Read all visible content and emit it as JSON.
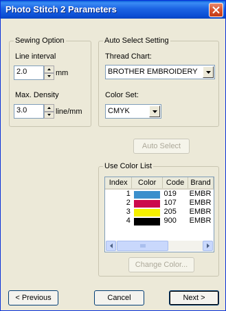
{
  "window": {
    "title": "Photo Stitch 2 Parameters"
  },
  "sewing_option": {
    "legend": "Sewing Option",
    "line_interval": {
      "label": "Line interval",
      "value": "2.0",
      "unit": "mm"
    },
    "max_density": {
      "label": "Max. Density",
      "value": "3.0",
      "unit": "line/mm"
    }
  },
  "auto_select_setting": {
    "legend": "Auto Select Setting",
    "thread_chart": {
      "label": "Thread Chart:",
      "value": "BROTHER EMBROIDERY"
    },
    "color_set": {
      "label": "Color Set:",
      "value": "CMYK"
    }
  },
  "auto_select_button": "Auto Select",
  "use_color_list": {
    "legend": "Use Color List",
    "columns": [
      "Index",
      "Color",
      "Code",
      "Brand"
    ],
    "rows": [
      {
        "index": "1",
        "color": "#3b8fcc",
        "code": "019",
        "brand": "EMBR"
      },
      {
        "index": "2",
        "color": "#cc0a4c",
        "code": "107",
        "brand": "EMBR"
      },
      {
        "index": "3",
        "color": "#f5f000",
        "code": "205",
        "brand": "EMBR"
      },
      {
        "index": "4",
        "color": "#000000",
        "code": "900",
        "brand": "EMBR"
      }
    ],
    "change_color_button": "Change Color..."
  },
  "footer": {
    "previous_button": "< Previous",
    "cancel_button": "Cancel",
    "next_button": "Next >"
  }
}
